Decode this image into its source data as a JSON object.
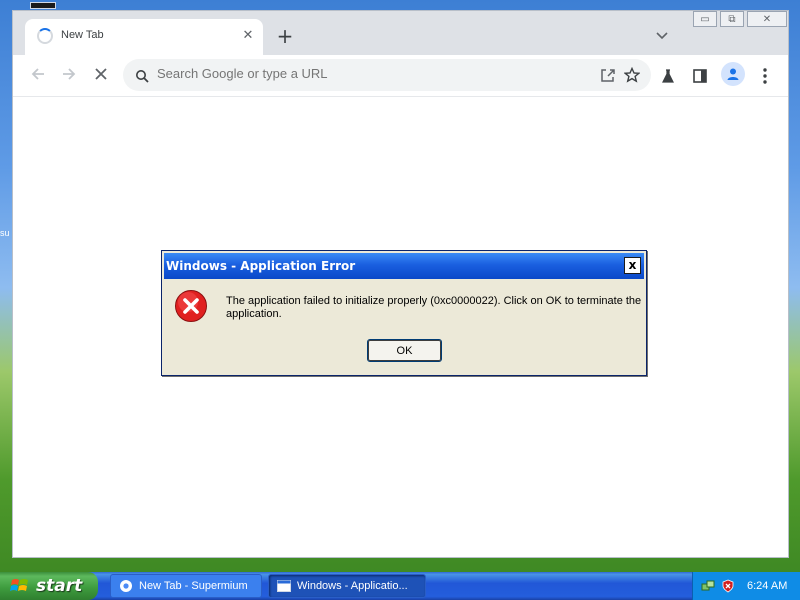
{
  "desktop": {
    "label_fragment": "su"
  },
  "browser": {
    "tab": {
      "title": "New Tab",
      "close_glyph": "✕"
    },
    "new_tab_glyph": "+",
    "window_controls": {
      "minimize": "▭",
      "restore": "⧉",
      "close": "✕"
    },
    "omnibox": {
      "placeholder": "Search Google or type a URL"
    },
    "icons": [
      "back-arrow-icon",
      "forward-arrow-icon",
      "stop-loading-icon",
      "search-icon",
      "share-icon",
      "bookmark-star-icon",
      "labs-flask-icon",
      "side-panel-icon",
      "profile-icon",
      "menu-icon",
      "tab-search-icon"
    ]
  },
  "dialog": {
    "title": "Windows - Application Error",
    "close_glyph": "x",
    "message": "The application failed to initialize properly (0xc0000022). Click on OK to terminate the application.",
    "ok_label": "OK",
    "icon": "error-icon"
  },
  "taskbar": {
    "start_label": "start",
    "buttons": [
      {
        "label": "New Tab - Supermium",
        "icon": "browser-icon",
        "active": false
      },
      {
        "label": "Windows - Applicatio...",
        "icon": "window-icon",
        "active": true
      }
    ],
    "clock": "6:24 AM",
    "tray_icons": [
      "network-icon",
      "security-shield-icon"
    ]
  },
  "colors": {
    "xp_title_blue": "#0a48c8",
    "dialog_bg": "#ece9d8",
    "error_red": "#e02020",
    "taskbar_blue": "#245edc",
    "start_green": "#3f9d3f"
  }
}
